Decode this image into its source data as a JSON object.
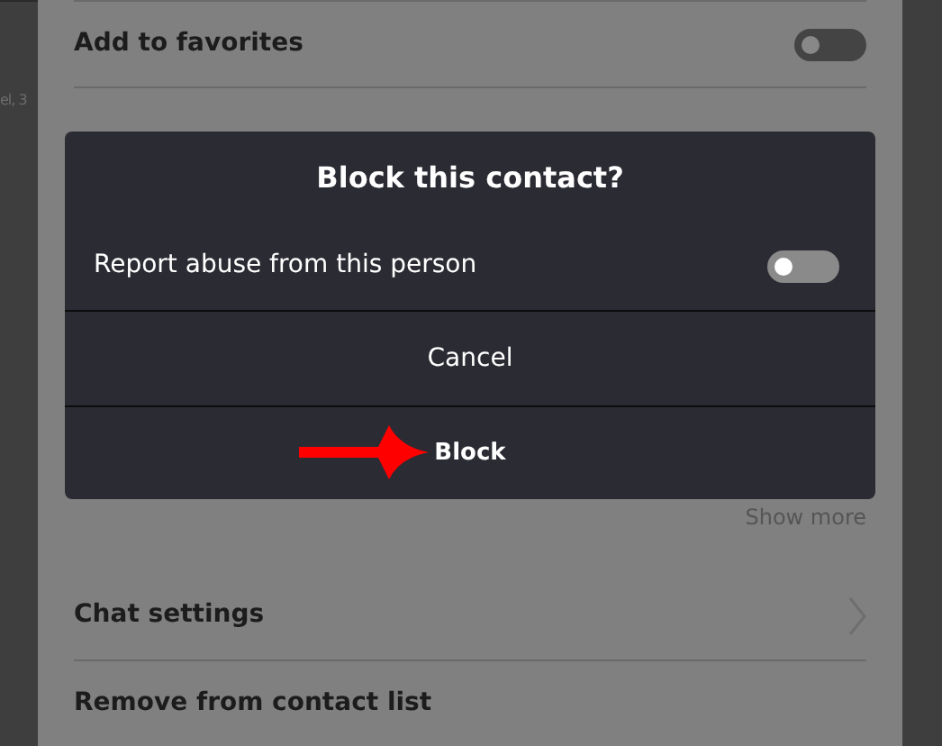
{
  "background_text": "el, 3",
  "settings_top": {
    "label": "Add to favorites",
    "on": false
  },
  "dialog": {
    "title": "Block this contact?",
    "option": {
      "label": "Report abuse from this person",
      "on": false
    },
    "buttons": [
      {
        "label": "Cancel",
        "kind": "plain"
      },
      {
        "label": "Block",
        "kind": "strong"
      }
    ]
  },
  "show_more": "Show more",
  "settings_bottom": [
    {
      "label": "Chat settings",
      "kind": "chevron"
    },
    {
      "label": "Remove from contact list",
      "kind": "plain"
    }
  ]
}
